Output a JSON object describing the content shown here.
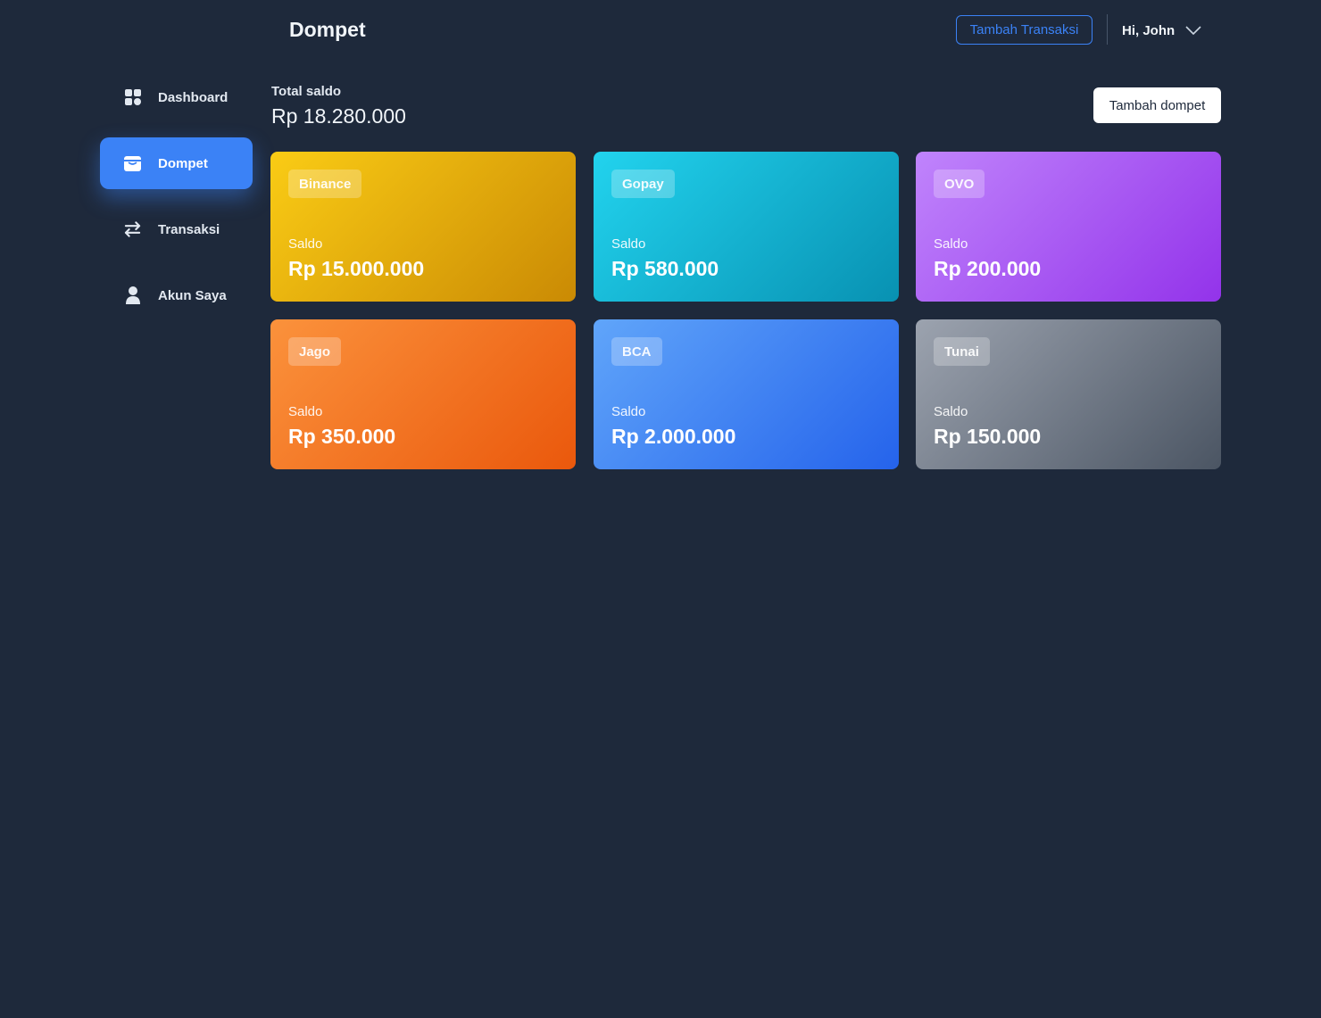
{
  "header": {
    "title": "Dompet",
    "add_transaction_label": "Tambah Transaksi",
    "user_greeting": "Hi, John"
  },
  "sidebar": {
    "items": [
      {
        "label": "Dashboard",
        "icon": "grid-icon",
        "active": false
      },
      {
        "label": "Dompet",
        "icon": "wallet-icon",
        "active": true
      },
      {
        "label": "Transaksi",
        "icon": "arrows-exchange-icon",
        "active": false
      },
      {
        "label": "Akun Saya",
        "icon": "user-icon",
        "active": false
      }
    ]
  },
  "summary": {
    "total_label": "Total saldo",
    "total_value": "Rp 18.280.000",
    "add_wallet_label": "Tambah dompet"
  },
  "wallets": [
    {
      "name": "Binance",
      "saldo_label": "Saldo",
      "saldo": "Rp 15.000.000",
      "color_from": "#facc15",
      "color_to": "#ca8a04"
    },
    {
      "name": "Gopay",
      "saldo_label": "Saldo",
      "saldo": "Rp 580.000",
      "color_from": "#22d3ee",
      "color_to": "#0891b2"
    },
    {
      "name": "OVO",
      "saldo_label": "Saldo",
      "saldo": "Rp 200.000",
      "color_from": "#c084fc",
      "color_to": "#9333ea"
    },
    {
      "name": "Jago",
      "saldo_label": "Saldo",
      "saldo": "Rp 350.000",
      "color_from": "#fb923c",
      "color_to": "#ea580c"
    },
    {
      "name": "BCA",
      "saldo_label": "Saldo",
      "saldo": "Rp 2.000.000",
      "color_from": "#60a5fa",
      "color_to": "#2563eb"
    },
    {
      "name": "Tunai",
      "saldo_label": "Saldo",
      "saldo": "Rp 150.000",
      "color_from": "#9ca3af",
      "color_to": "#4b5563"
    }
  ],
  "colors": {
    "background": "#1e293b",
    "accent": "#3b82f6"
  }
}
